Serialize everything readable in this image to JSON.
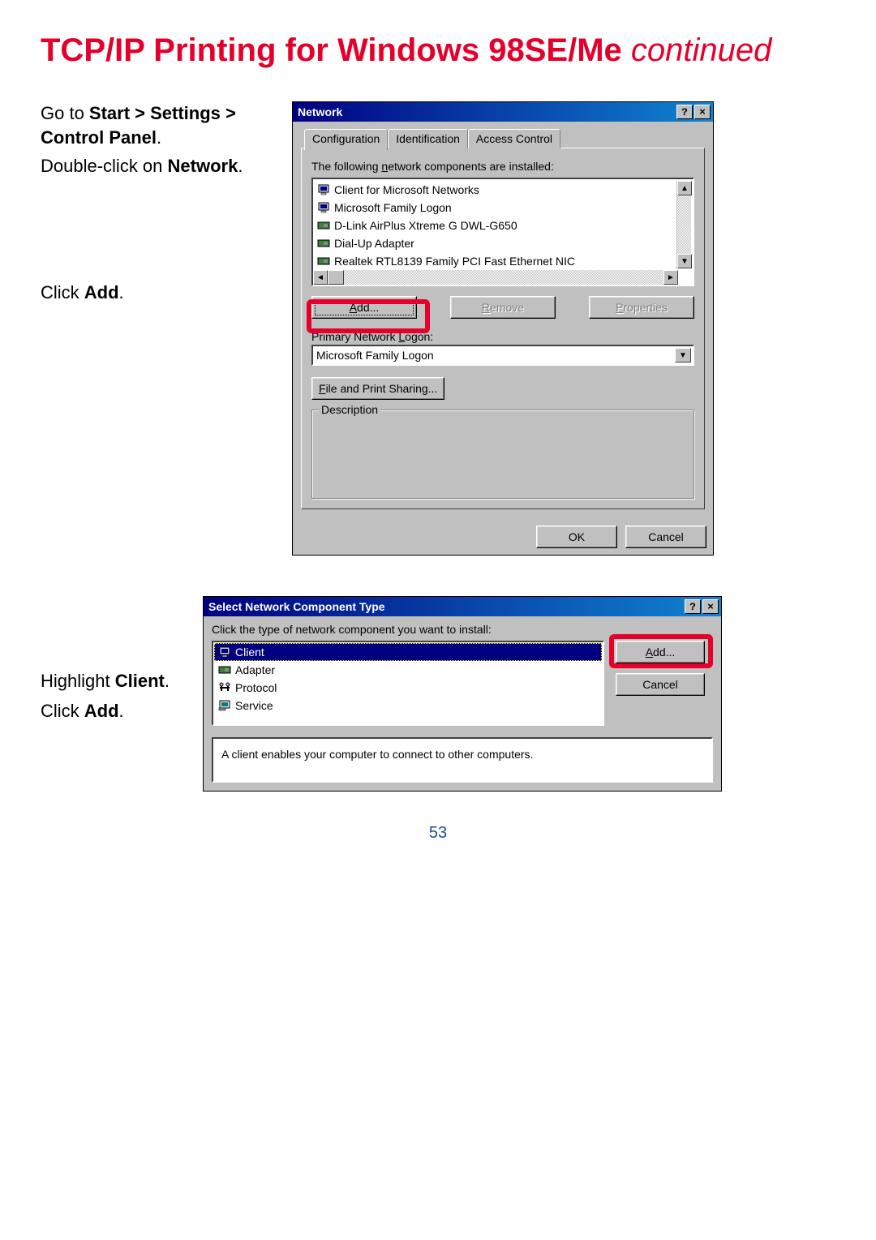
{
  "page_title_main": "TCP/IP Printing for Windows 98SE/Me ",
  "page_title_cont": "continued",
  "page_number": "53",
  "instructions": {
    "step1a": "Go to ",
    "step1b_bold": "Start > Settings > Control Panel",
    "step1c": ".",
    "step2a": "Double-click on ",
    "step2b_bold": "Network",
    "step2c": ".",
    "step3a": "Click ",
    "step3b_bold": "Add",
    "step3c": "."
  },
  "instructions2": {
    "line1a": "Highlight ",
    "line1b_bold": "Client",
    "line1c": ".",
    "line2a": "Click ",
    "line2b_bold": "Add",
    "line2c": "."
  },
  "network_dialog": {
    "title": "Network",
    "tabs": [
      "Configuration",
      "Identification",
      "Access Control"
    ],
    "active_tab": 0,
    "installed_label_pre": "The following ",
    "installed_label_u": "n",
    "installed_label_post": "etwork components are installed:",
    "components": [
      {
        "name": "Client for Microsoft Networks",
        "icon": "client"
      },
      {
        "name": "Microsoft Family Logon",
        "icon": "client"
      },
      {
        "name": "D-Link AirPlus Xtreme G DWL-G650",
        "icon": "adapter"
      },
      {
        "name": "Dial-Up Adapter",
        "icon": "adapter"
      },
      {
        "name": "Realtek RTL8139 Family PCI Fast Ethernet NIC",
        "icon": "adapter"
      }
    ],
    "btn_add_u": "A",
    "btn_add": "dd...",
    "btn_remove": "Remove",
    "btn_remove_u": "R",
    "btn_remove_post": "emove",
    "btn_properties": "Properties",
    "btn_properties_u": "P",
    "btn_properties_post": "roperties",
    "primary_logon_label_pre": "Primary Network ",
    "primary_logon_label_u": "L",
    "primary_logon_label_post": "ogon:",
    "primary_logon_value": "Microsoft Family Logon",
    "file_print_u": "F",
    "file_print": "ile and Print Sharing...",
    "description_legend": "Description",
    "description_text": "",
    "btn_ok": "OK",
    "btn_cancel": "Cancel"
  },
  "select_dialog": {
    "title": "Select Network Component Type",
    "prompt": "Click the type of network component you want to install:",
    "types": [
      {
        "name": "Client",
        "icon": "client",
        "selected": true
      },
      {
        "name": "Adapter",
        "icon": "adapter"
      },
      {
        "name": "Protocol",
        "icon": "protocol"
      },
      {
        "name": "Service",
        "icon": "service"
      }
    ],
    "btn_add_u": "A",
    "btn_add": "dd...",
    "btn_cancel": "Cancel",
    "description": "A client enables your computer to connect to other computers."
  }
}
